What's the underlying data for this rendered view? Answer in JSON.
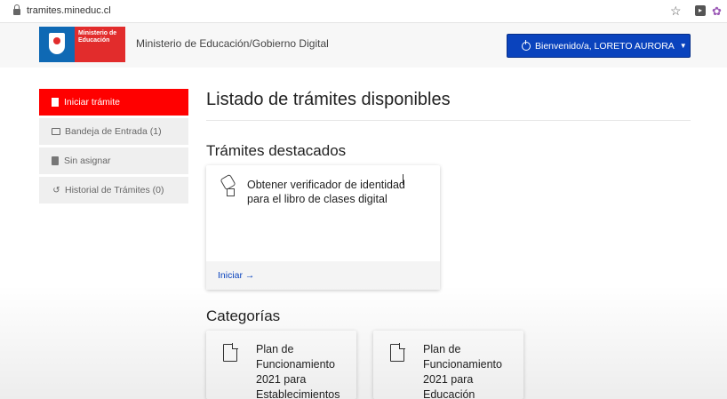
{
  "browser": {
    "url": "tramites.mineduc.cl"
  },
  "header": {
    "logo_text": "Ministerio de Educación",
    "org_title": "Ministerio de Educación/Gobierno Digital",
    "welcome_label": "Bienvenido/a, LORETO AURORA"
  },
  "sidebar": {
    "items": [
      {
        "label": "Iniciar trámite",
        "active": true
      },
      {
        "label": "Bandeja de Entrada (1)",
        "active": false
      },
      {
        "label": "Sin asignar",
        "active": false
      },
      {
        "label": "Historial de Trámites (0)",
        "active": false
      }
    ]
  },
  "main": {
    "title": "Listado de trámites disponibles",
    "featured_heading": "Trámites destacados",
    "featured_card": {
      "title": "Obtener verificador de identidad para el libro de clases digital",
      "action": "Iniciar →"
    },
    "categories_heading": "Categorías",
    "categories": [
      {
        "label": "Plan de Funcionamiento 2021 para Establecimientos"
      },
      {
        "label": "Plan de Funcionamiento 2021 para Educación"
      }
    ]
  },
  "colors": {
    "accent_blue": "#0a43bd",
    "active_red": "#ff0000",
    "logo_blue": "#0f69b4",
    "logo_red": "#e22c2c"
  }
}
